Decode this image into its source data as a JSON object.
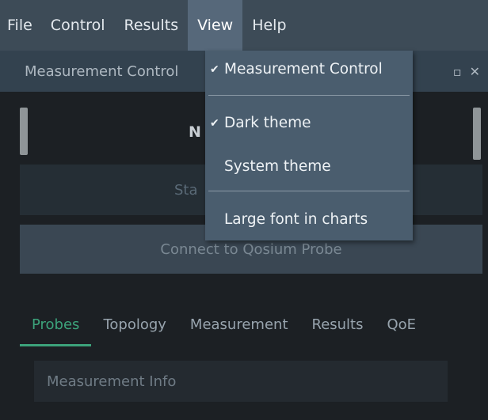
{
  "menubar": {
    "items": [
      "File",
      "Control",
      "Results",
      "View",
      "Help"
    ]
  },
  "panel": {
    "title": "Measurement Control",
    "restore_icon": "restore-window-icon",
    "close_icon": "close-icon"
  },
  "content": {
    "status_partial": "N",
    "start_button_partial": "Sta",
    "connect_button": "Connect to Qosium Probe"
  },
  "tabs": [
    "Probes",
    "Topology",
    "Measurement",
    "Results",
    "QoE"
  ],
  "info_box": {
    "label": "Measurement Info"
  },
  "view_menu": {
    "items": [
      {
        "label": "Measurement Control",
        "checked": true
      },
      {
        "label": "Dark theme",
        "checked": true
      },
      {
        "label": "System theme",
        "checked": false
      },
      {
        "label": "Large font in charts",
        "checked": false
      }
    ],
    "checkmark": "✔"
  },
  "colors": {
    "menubar": "#3d4b57",
    "accent_green": "#3ca37b",
    "dropdown": "#4a5d6e"
  }
}
